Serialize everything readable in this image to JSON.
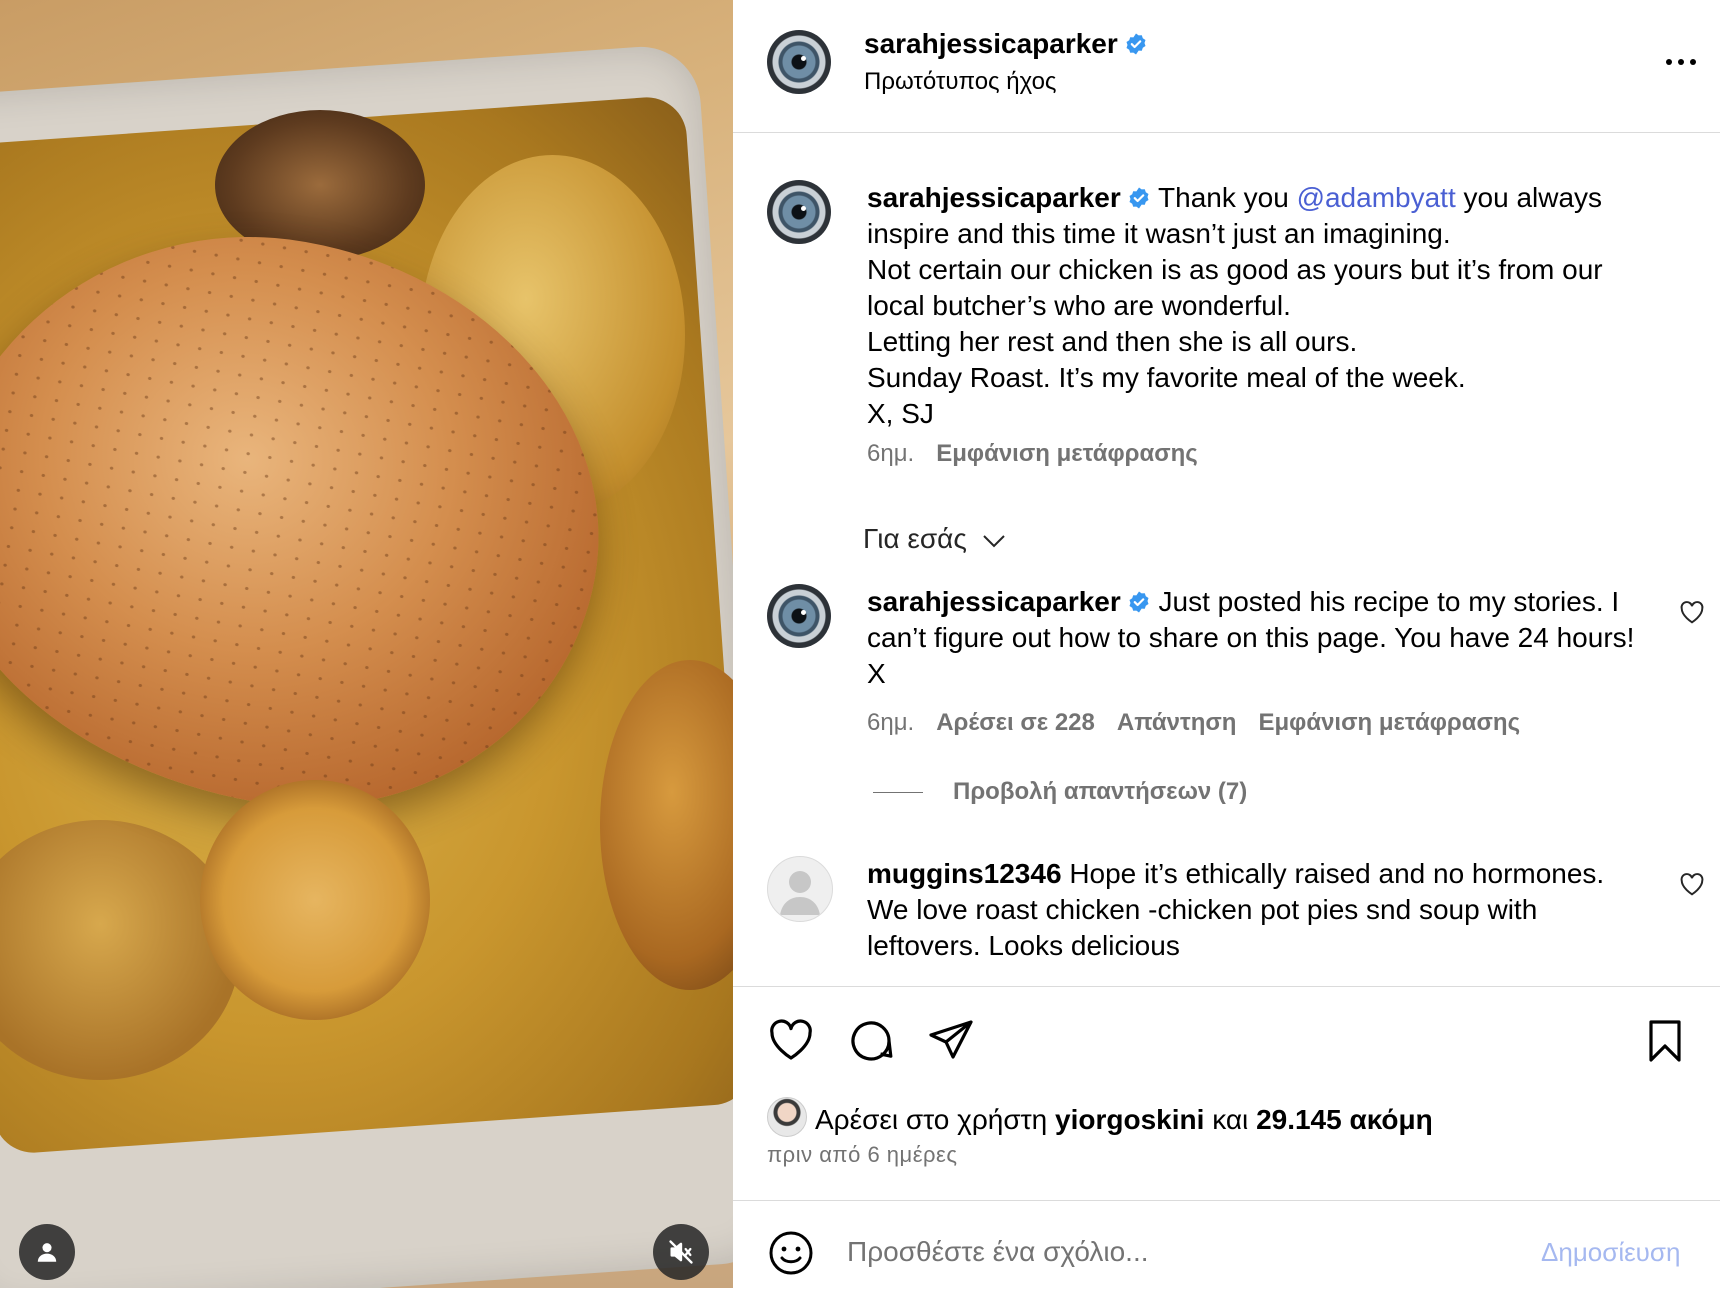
{
  "post": {
    "username": "sarahjessicaparker",
    "audio_label": "Πρωτότυπος ήχος"
  },
  "caption": {
    "username": "sarahjessicaparker",
    "text_before_mention": "Thank you ",
    "mention": "@adambyatt",
    "text_after_mention": " you always inspire and this time it wasn’t just an imagining.",
    "lines": [
      "Not certain our chicken is as good as yours but it’s from our local butcher’s who are wonderful.",
      "Letting her rest and then she is all ours.",
      "Sunday Roast. It’s my favorite meal of the week.",
      "X, SJ"
    ],
    "time": "6ημ.",
    "translate_label": "Εμφάνιση μετάφρασης"
  },
  "sort_label": "Για εσάς",
  "comments": [
    {
      "username": "sarahjessicaparker",
      "text": "Just posted his recipe to my stories. I can’t figure out how to share on this page. You have 24 hours! X",
      "time": "6ημ.",
      "likes_label": "Αρέσει σε 228",
      "reply_label": "Απάντηση",
      "translate_label": "Εμφάνιση μετάφρασης",
      "view_replies_label": "Προβολή απαντήσεων (7)"
    },
    {
      "username": "muggins12346",
      "text": "Hope it’s ethically raised and no hormones. We love roast chicken -chicken pot pies snd soup with leftovers. Looks delicious"
    }
  ],
  "likes": {
    "prefix": "Αρέσει στο χρήστη",
    "user": "yiorgoskini",
    "middle": "και",
    "count_label": "29.145 ακόμη"
  },
  "timestamp": "πριν από 6 ημέρες",
  "composer": {
    "placeholder": "Προσθέστε ένα σχόλιο...",
    "post_label": "Δημοσίευση"
  },
  "icons": {
    "verified": "verified-badge-icon",
    "more": "more-options-icon",
    "like": "heart-icon",
    "comment": "comment-icon",
    "share": "paper-plane-icon",
    "save": "bookmark-icon",
    "emoji": "emoji-icon",
    "mute": "speaker-muted-icon",
    "tag": "user-tag-icon"
  },
  "colors": {
    "mention": "#4a5fd3",
    "verified": "#3897f0",
    "secondary_text": "#737373",
    "post_button": "#a5b8f0"
  }
}
